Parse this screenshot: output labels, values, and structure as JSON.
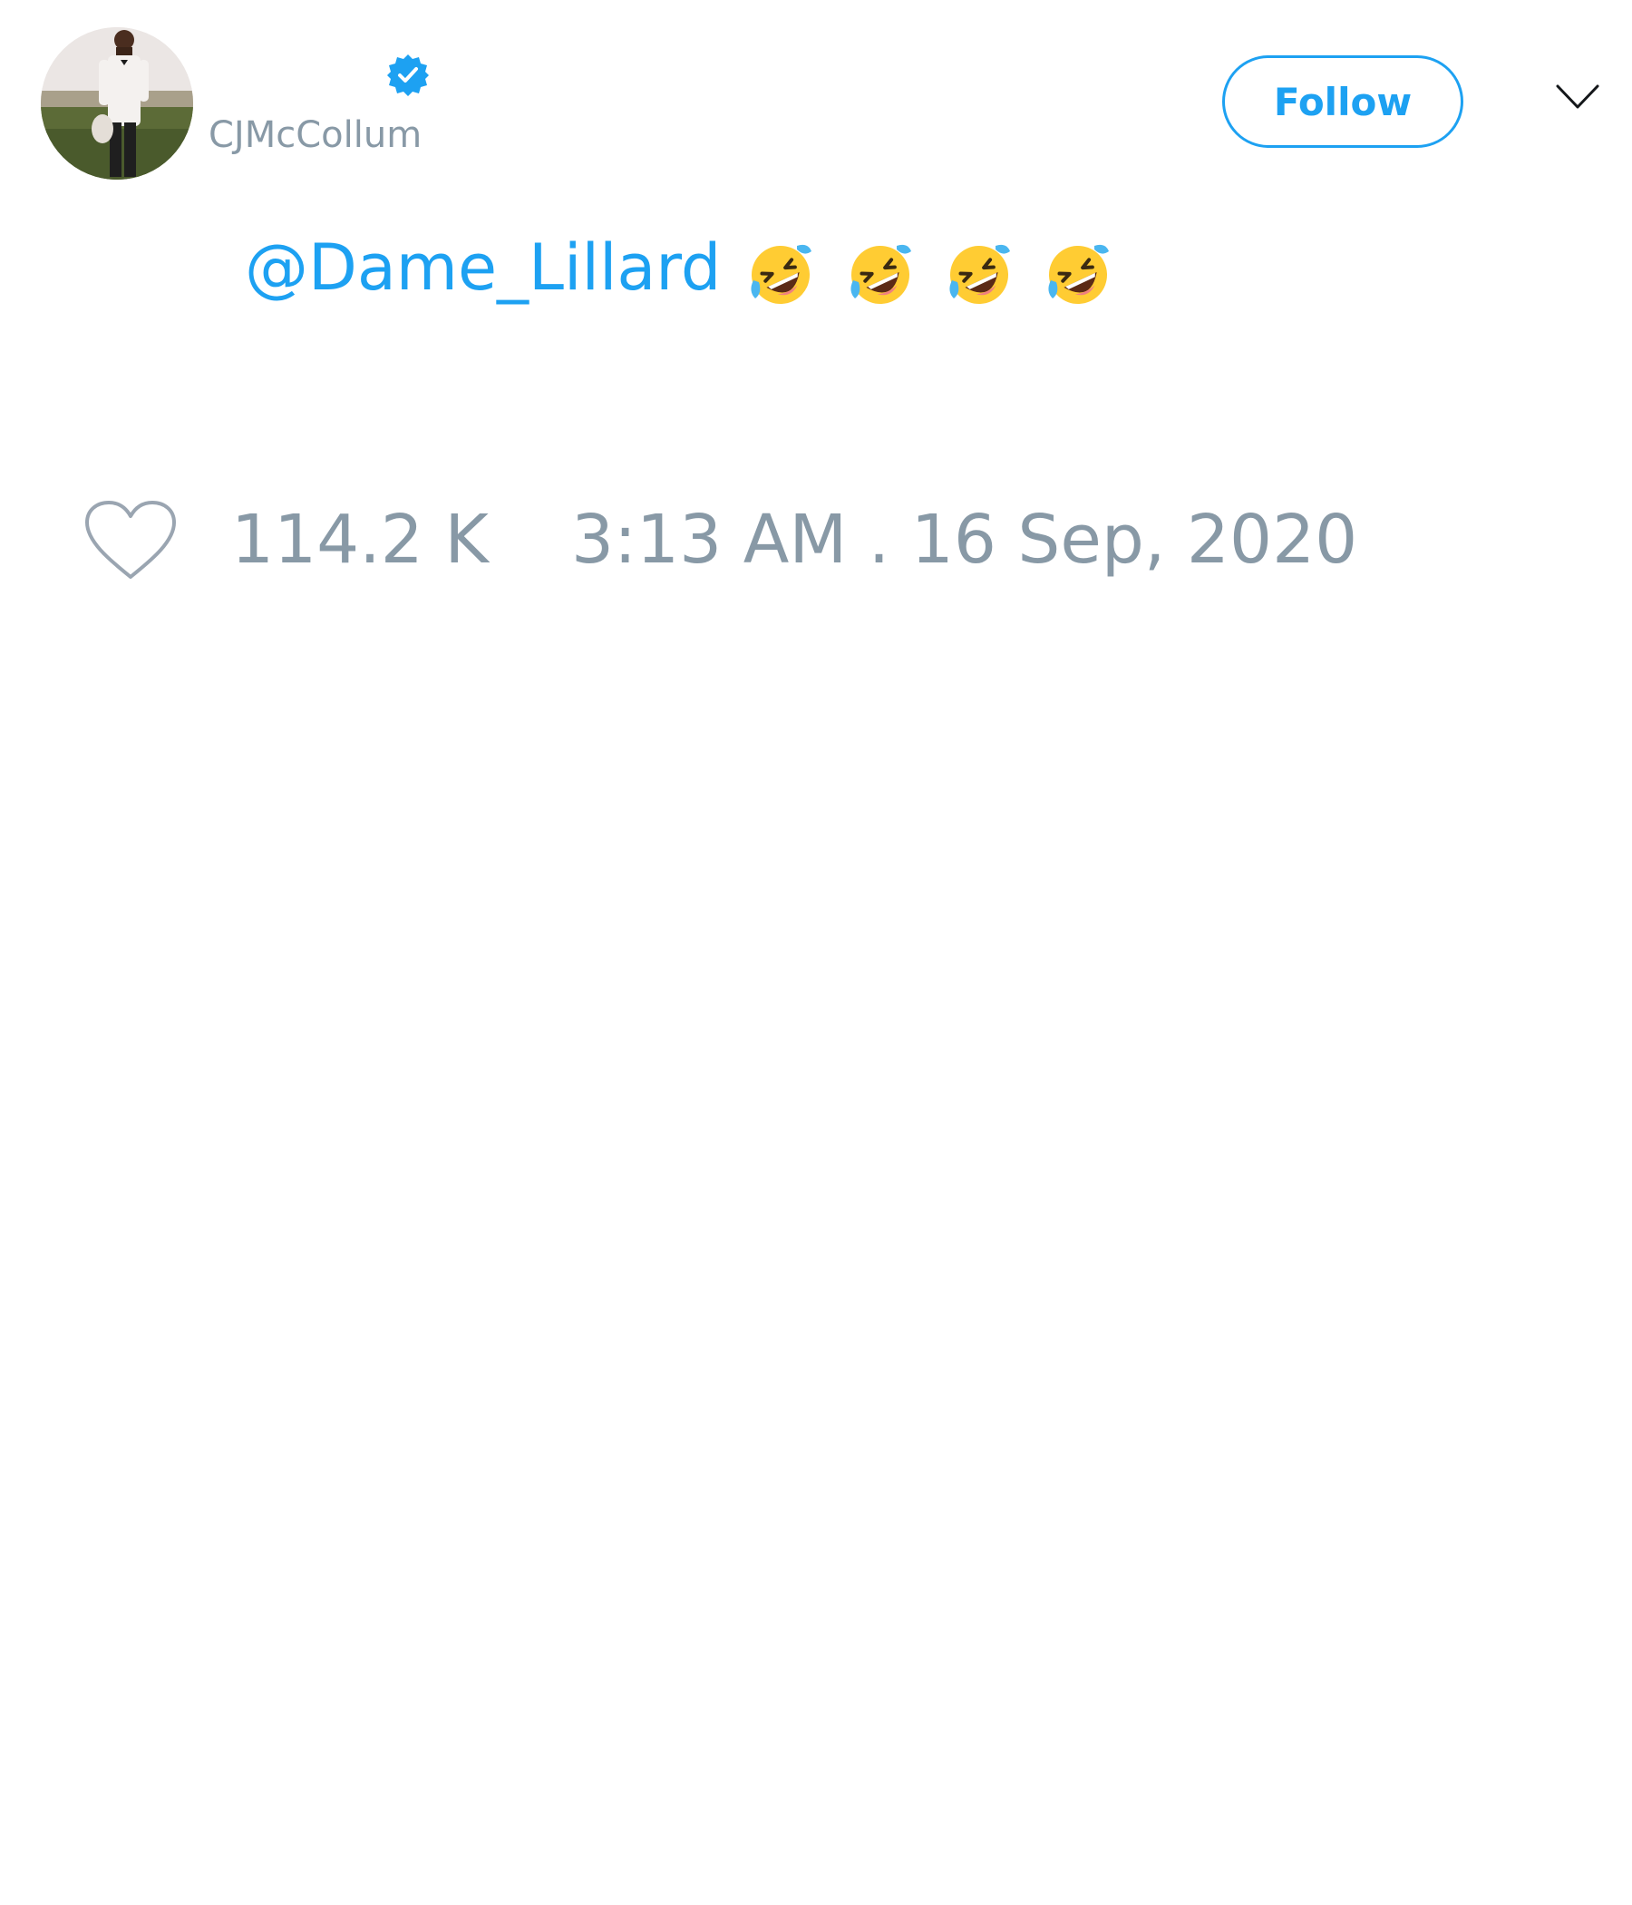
{
  "user": {
    "display_name": "",
    "handle": "CJMcCollum",
    "verified": true,
    "avatar_icon": "profile-photo"
  },
  "follow_button": {
    "label": "Follow"
  },
  "menu_icon": "chevron-down-icon",
  "tweet": {
    "mention": "@Dame_Lillard",
    "emoji_name": "rolling-on-the-floor-laughing",
    "emoji_count": 4
  },
  "engagement": {
    "like_icon": "heart-outline-icon",
    "likes": "114.2 K",
    "timestamp": "3:13 AM . 16 Sep, 2020"
  },
  "colors": {
    "link_blue": "#1da1f2",
    "muted_gray": "#8899a6",
    "dark_text": "#14171a",
    "background": "#ffffff"
  }
}
